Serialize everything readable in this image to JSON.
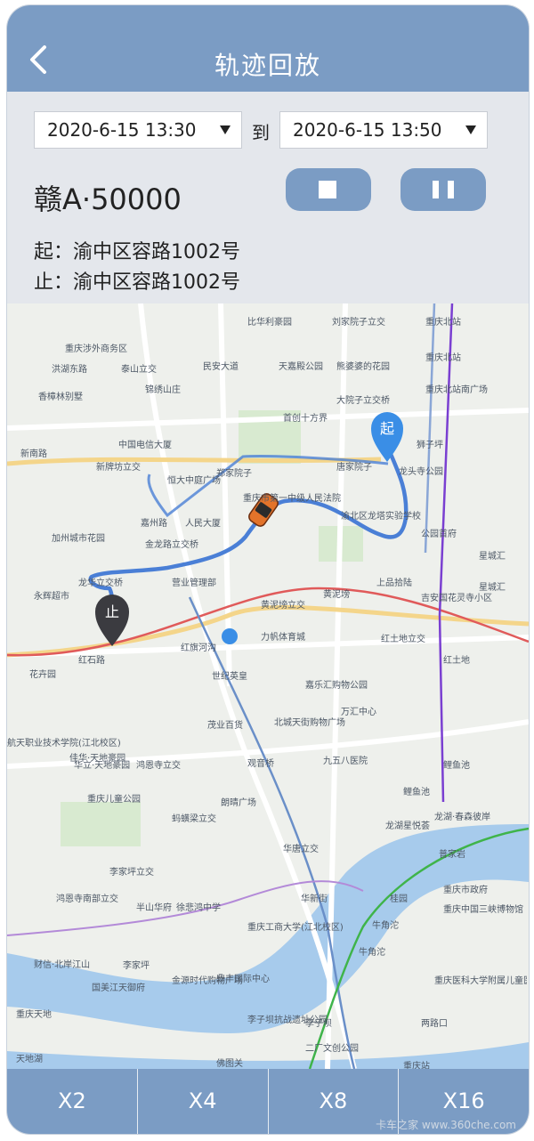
{
  "header": {
    "title": "轨迹回放"
  },
  "query": {
    "start_time": "2020-6-15 13:30",
    "to_label": "到",
    "end_time": "2020-6-15 13:50"
  },
  "vehicle": {
    "plate": "赣A·50000",
    "start_label": "起：",
    "start_address": "渝中区容路1002号",
    "end_label": "止：",
    "end_address": "渝中区容路1002号"
  },
  "map": {
    "start_marker": "起",
    "end_marker": "止",
    "labels": [
      "比华利豪园",
      "刘家院子立交",
      "重庆北站",
      "重庆北站",
      "洪湖东路",
      "泰山立交",
      "民安大道",
      "天嘉殿公园",
      "熊婆婆的花园",
      "重庆北站南广场",
      "锦绣山庄",
      "大院子立交桥",
      "首创十方界",
      "中国电信大厦",
      "狮子坪",
      "新牌坊立交",
      "恒大中庭广场",
      "郑家院子",
      "唐家院子",
      "龙头寺公园",
      "重庆市第一中级人民法院",
      "渝北区龙塔实验学校",
      "嘉州路",
      "人民大厦",
      "公园首府",
      "金龙路立交桥",
      "加州城市花园",
      "星城汇",
      "龙华立交桥",
      "营业管理部",
      "上品拾陆",
      "吉安国花灵寺小区",
      "永辉超市",
      "黄泥塝立交",
      "黄泥塝",
      "红旗河沟",
      "力帆体育城",
      "红土地立交",
      "红土地",
      "红石路",
      "花卉园",
      "世纪英皇",
      "嘉乐汇购物公园",
      "万汇中心",
      "茂业百货",
      "北城天街购物广场",
      "九五八医院",
      "鸿恩寺立交",
      "观音桥",
      "华立·天地豪园",
      "重庆儿童公园",
      "朗晴广场",
      "鲤鱼池",
      "鲤鱼池",
      "龙湖星悦荟",
      "龙湖·春森彼岸",
      "蚂蟥梁立交",
      "华唐立交",
      "李家坪立交",
      "华新街",
      "普家岩",
      "鸿恩寺南部立交",
      "重庆市政府",
      "半山华府",
      "徐悲鸿中学",
      "桂园",
      "重庆中国三峡博物馆",
      "牛角沱",
      "牛角沱",
      "重庆工商大学(江北校区)",
      "财信·北岸江山",
      "国美江天御府",
      "金源时代购物广场",
      "鼎丰国际中心",
      "重庆医科大学附属儿童医院",
      "李子坝抗战遗址公园",
      "李子坝",
      "二厂文创公园",
      "两路口",
      "佛图关",
      "华村立交",
      "重庆站",
      "天地湖",
      "重庆天地",
      "李家坪",
      "佳华·天地豪园",
      "航天职业技术学院(江北校区)",
      "重庆涉外商务区",
      "香樟林别墅",
      "新南路",
      "星城汇"
    ]
  },
  "speeds": [
    "X2",
    "X4",
    "X8",
    "X16"
  ],
  "watermark": "卡车之家 www.360che.com",
  "colors": {
    "accent": "#7b9cc4",
    "track": "#4a7fd6"
  }
}
